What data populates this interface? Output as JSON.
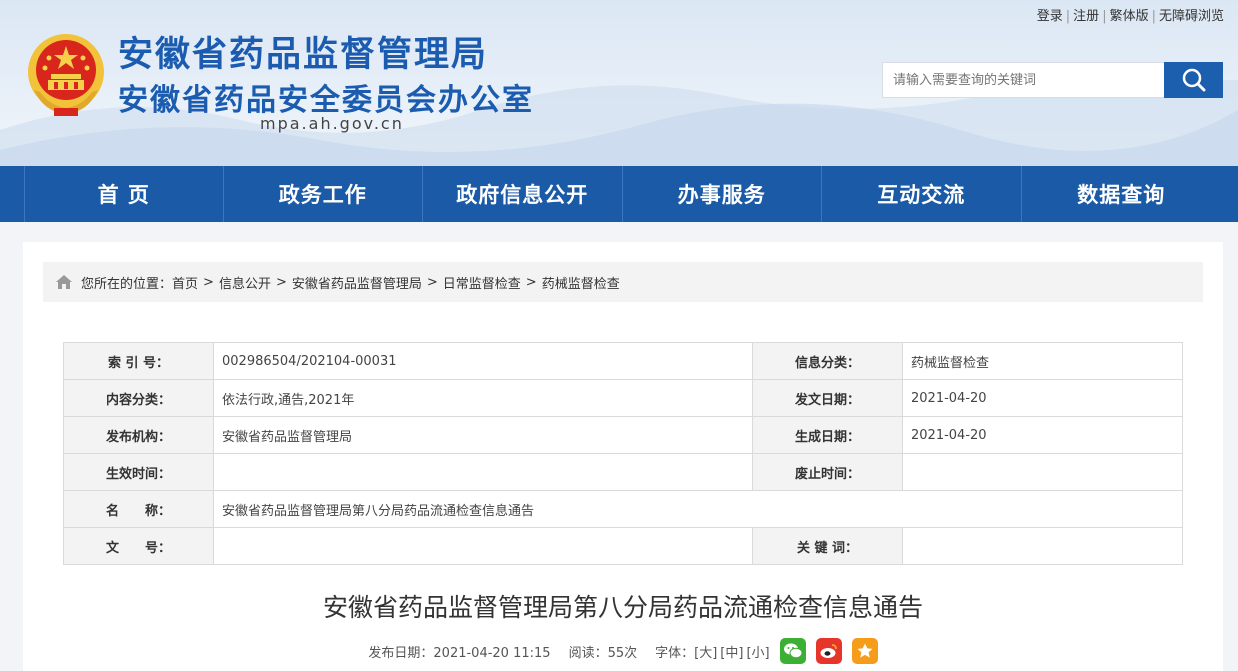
{
  "header": {
    "title_main": "安徽省药品监督管理局",
    "title_sub": "安徽省药品安全委员会办公室",
    "domain": "mpa.ah.gov.cn",
    "toplinks": [
      "登录",
      "注册",
      "繁体版",
      "无障碍浏览"
    ],
    "search_placeholder": "请输入需要查询的关键词",
    "brand_color": "#1b5aa6"
  },
  "nav": {
    "items": [
      "首 页",
      "政务工作",
      "政府信息公开",
      "办事服务",
      "互动交流",
      "数据查询"
    ]
  },
  "breadcrumb": {
    "prefix": "您所在的位置：",
    "items": [
      "首页",
      "信息公开",
      "安徽省药品监督管理局",
      "日常监督检查",
      "药械监督检查"
    ]
  },
  "meta": {
    "index_label": "索 引 号：",
    "index_value": "002986504/202104-00031",
    "category_label": "信息分类：",
    "category_value": "药械监督检查",
    "content_label": "内容分类：",
    "content_value": "依法行政,通告,2021年",
    "issue_label": "发文日期：",
    "issue_value": "2021-04-20",
    "org_label": "发布机构：",
    "org_value": "安徽省药品监督管理局",
    "gen_label": "生成日期：",
    "gen_value": "2021-04-20",
    "effective_label": "生效时间：",
    "effective_value": "",
    "abolish_label": "废止时间：",
    "abolish_value": "",
    "name_label": "名　　称：",
    "name_value": "安徽省药品监督管理局第八分局药品流通检查信息通告",
    "docno_label": "文　　号：",
    "docno_value": "",
    "keyword_label": "关 键 词：",
    "keyword_value": ""
  },
  "article": {
    "title": "安徽省药品监督管理局第八分局药品流通检查信息通告",
    "publish": "发布日期：2021-04-20 11:15",
    "views": "阅读：55次",
    "font_label": "字体：",
    "font_large": "[大]",
    "font_medium": "[中]",
    "font_small": "[小]",
    "share_icons": [
      "wechat-icon",
      "weibo-icon",
      "favorite-icon"
    ]
  }
}
